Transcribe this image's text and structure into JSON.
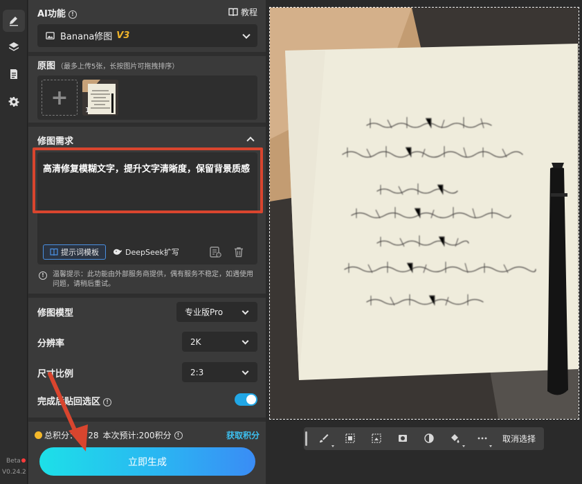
{
  "rail": {
    "beta": "Beta",
    "version": "V0.24.2"
  },
  "header": {
    "title": "AI功能",
    "tutorial": "教程"
  },
  "model_select": {
    "name": "Banana修图",
    "version": "V3"
  },
  "original": {
    "title": "原图",
    "hint": "（最多上传5张，长按图片可拖拽排序）",
    "thumb_index": "1"
  },
  "requirement": {
    "title": "修图需求",
    "text": "高清修复模糊文字，提升文字清晰度，保留背景质感",
    "template_button": "提示词模板",
    "deepseek_button": "DeepSeek扩写"
  },
  "notice": "温馨提示：此功能由外部服务商提供，偶有服务不稳定，如遇使用问题，请稍后重试。",
  "settings": {
    "model_label": "修图模型",
    "model_value": "专业版Pro",
    "resolution_label": "分辨率",
    "resolution_value": "2K",
    "ratio_label": "尺寸比例",
    "ratio_value": "2:3",
    "paste_back_label": "完成后贴回选区",
    "paste_back_on": true
  },
  "points": {
    "total_label": "总积分：3728",
    "estimate_label": "本次预计:200积分",
    "get_points": "获取积分"
  },
  "generate_button": "立即生成",
  "image_toolbar": {
    "cancel_selection": "取消选择"
  },
  "photo": {
    "lines": [
      "有时候生活就像",
      "你从超市拎出来两大袋东西",
      "好重 好沉 好累",
      "细细的塑料袋勒的手很疼",
      "两只手来回倒腾",
      "可是没有哪一次，你是拎不回家的。",
      "我的意思是都能过去。"
    ]
  },
  "colors": {
    "accent_blue": "#21a7e6",
    "highlight_red": "#d9452e",
    "v3_gold": "#f0b42a",
    "link_blue": "#3cc0f0"
  }
}
